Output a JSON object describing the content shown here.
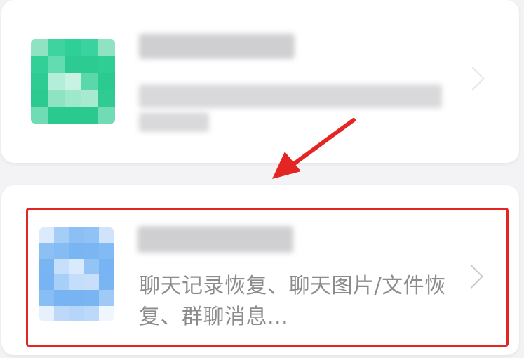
{
  "cards": [
    {
      "id": "card-1",
      "icon": "app-icon-green",
      "title_obscured": true,
      "description_obscured": true
    },
    {
      "id": "card-2",
      "icon": "app-icon-blue",
      "title_obscured": true,
      "description": "聊天记录恢复、聊天图片/文件恢复、群聊消息..."
    }
  ],
  "annotation": {
    "arrow_color": "#e32623",
    "box_color": "#e32623"
  },
  "colors": {
    "background": "#f3f3f5",
    "card": "#ffffff",
    "text_secondary": "#8c8c8f",
    "green_icon": "#2ec98f",
    "blue_icon": "#7db8f5"
  }
}
